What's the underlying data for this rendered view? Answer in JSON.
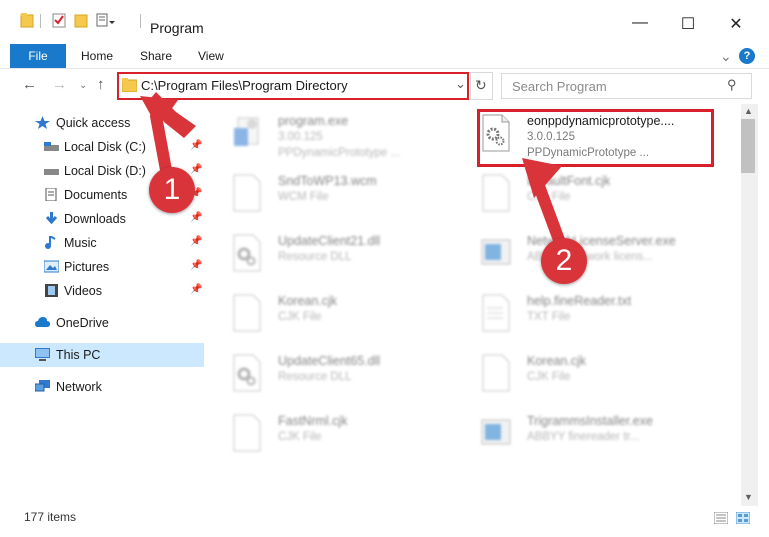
{
  "window": {
    "title": "Program",
    "minimize_glyph": "—",
    "maximize_glyph": "☐",
    "close_glyph": "✕"
  },
  "ribbon": {
    "file": "File",
    "home": "Home",
    "share": "Share",
    "view": "View",
    "expand_glyph": "⌄",
    "help_glyph": "?"
  },
  "address_bar": {
    "path": "C:\\Program Files\\Program Directory",
    "dropdown_glyph": "⌄",
    "refresh_glyph": "↻"
  },
  "search": {
    "placeholder": "Search Program",
    "icon_glyph": "⚲"
  },
  "sidebar": {
    "quick_access": "Quick access",
    "items": [
      {
        "label": "Local Disk (C:)",
        "icon": "drive-icon"
      },
      {
        "label": "Local Disk (D:)",
        "icon": "drive-icon"
      },
      {
        "label": "Documents",
        "icon": "documents-icon"
      },
      {
        "label": "Downloads",
        "icon": "downloads-icon"
      },
      {
        "label": "Music",
        "icon": "music-icon"
      },
      {
        "label": "Pictures",
        "icon": "pictures-icon"
      },
      {
        "label": "Videos",
        "icon": "videos-icon"
      }
    ],
    "onedrive": "OneDrive",
    "this_pc": "This PC",
    "network": "Network"
  },
  "files": [
    {
      "name": "program.exe",
      "line1": "3.00.125",
      "line2": "PPDynamicPrototype ...",
      "icon": "exe-icon"
    },
    {
      "name": "eonppdynamicprototype....",
      "line1": "3.0.0.125",
      "line2": "PPDynamicPrototype ...",
      "icon": "gear-file-icon"
    },
    {
      "name": "SndToWP13.wcm",
      "line1": "WCM File",
      "line2": "",
      "icon": "file-icon"
    },
    {
      "name": "DefaultFont.cjk",
      "line1": "CJK File",
      "line2": "",
      "icon": "file-icon"
    },
    {
      "name": "UpdateClient21.dll",
      "line1": "Resource DLL",
      "line2": "",
      "icon": "gear-file-icon"
    },
    {
      "name": "NetworkLicenseServer.exe",
      "line1": "ABBYY Network licens...",
      "line2": "",
      "icon": "app-icon"
    },
    {
      "name": "Korean.cjk",
      "line1": "CJK File",
      "line2": "",
      "icon": "file-icon"
    },
    {
      "name": "help.fineReader.txt",
      "line1": "TXT File",
      "line2": "",
      "icon": "text-file-icon"
    },
    {
      "name": "UpdateClient65.dll",
      "line1": "Resource DLL",
      "line2": "",
      "icon": "gear-file-icon"
    },
    {
      "name": "Korean.cjk",
      "line1": "CJK File",
      "line2": "",
      "icon": "file-icon"
    },
    {
      "name": "FastNrml.cjk",
      "line1": "CJK File",
      "line2": "",
      "icon": "file-icon"
    },
    {
      "name": "TrigrammsInstaller.exe",
      "line1": "ABBYY finereader tr...",
      "line2": "",
      "icon": "app-icon"
    }
  ],
  "status": {
    "item_count": "177 items"
  },
  "callouts": {
    "step1": "1",
    "step2": "2"
  },
  "colors": {
    "accent": "#1979ca",
    "highlight_red": "#d9202a",
    "selection": "#cce8ff"
  }
}
